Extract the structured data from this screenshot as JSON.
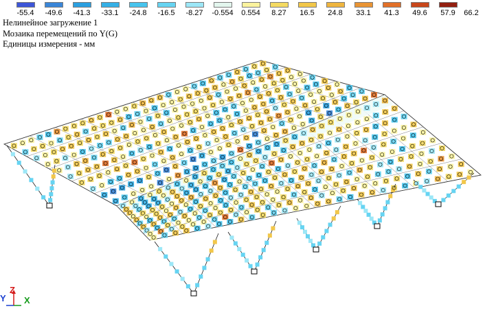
{
  "legend": {
    "ticks": [
      "-55.4",
      "-49.6",
      "-41.3",
      "-33.1",
      "-24.8",
      "-16.5",
      "-8.27",
      "-0.554",
      "0.554",
      "8.27",
      "16.5",
      "24.8",
      "33.1",
      "41.3",
      "49.6",
      "57.9",
      "66.2"
    ],
    "colors": [
      "#3d56d8",
      "#3a86d8",
      "#2b9fe0",
      "#35b0e6",
      "#47c4ee",
      "#66d4f2",
      "#9ce7f7",
      "#e3f6ee",
      "#fbf39e",
      "#f4da62",
      "#f2c74a",
      "#efb53f",
      "#e99434",
      "#e27028",
      "#c8471b",
      "#931f10"
    ]
  },
  "info": {
    "line1": "Нелинейное загружение 1",
    "line2": "Мозаика перемещений по Y(G)",
    "line3": "Единицы измерения - мм"
  },
  "axes": {
    "y": "Y",
    "z": "Z",
    "x": "X",
    "y_color": "#1a3fd0",
    "z_color": "#d41a1a",
    "x_color": "#149a1a"
  }
}
